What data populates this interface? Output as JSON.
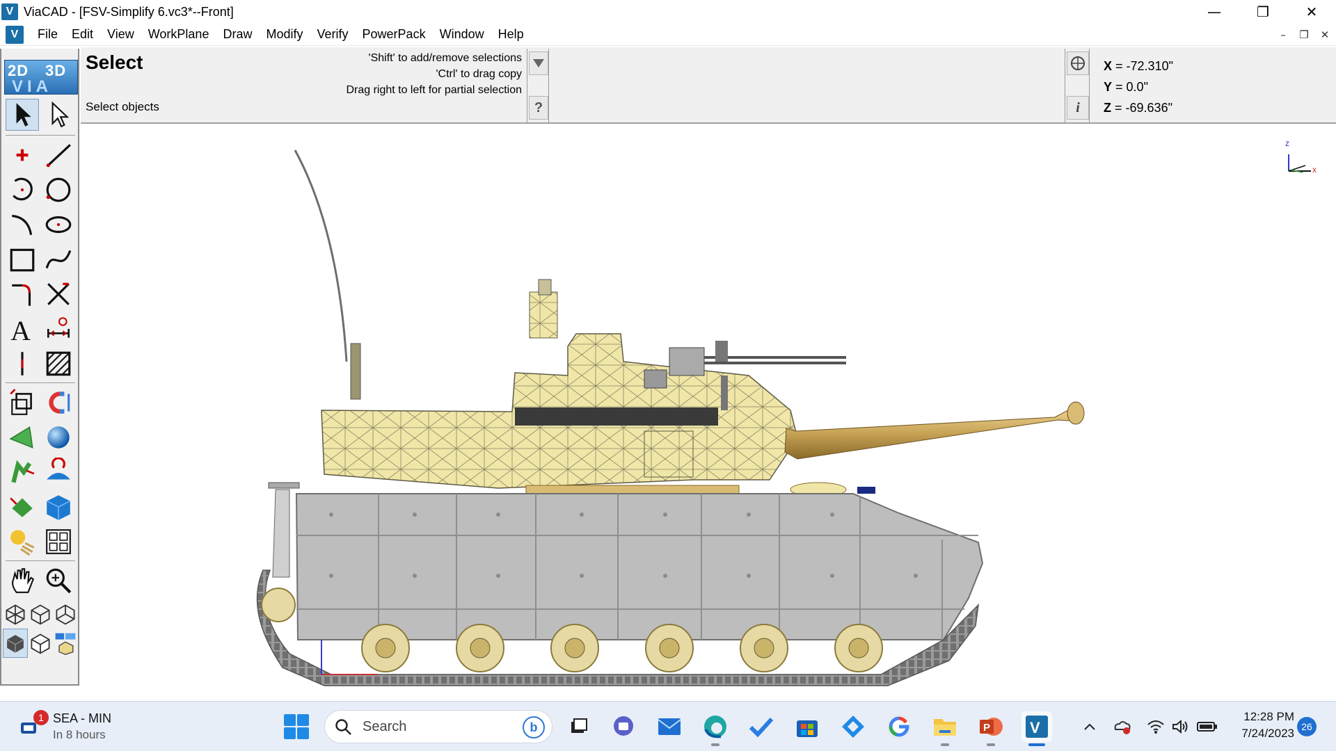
{
  "window": {
    "title": "ViaCAD - [FSV-Simplify 6.vc3*--Front]",
    "app_icon": "viacad-logo",
    "controls": [
      "minimize",
      "restore",
      "close"
    ]
  },
  "menu": {
    "items": [
      "File",
      "Edit",
      "View",
      "WorkPlane",
      "Draw",
      "Modify",
      "Verify",
      "PowerPack",
      "Window",
      "Help"
    ],
    "mdi_controls": [
      "minimize",
      "restore",
      "close"
    ]
  },
  "toolbar": {
    "logo": {
      "top_left": "2D",
      "top_right": "3D",
      "bottom": "VIA"
    },
    "tools": [
      "select-arrow",
      "select-hollow-arrow",
      "point",
      "line",
      "arc",
      "circle",
      "curve-arc",
      "ellipse",
      "rectangle",
      "spline",
      "fillet",
      "trim",
      "text",
      "dimension",
      "centerline",
      "hatch",
      "transform",
      "magnet",
      "extrude",
      "sphere",
      "sweep",
      "revolve",
      "shell",
      "box",
      "materials",
      "layout",
      "pan-hand",
      "zoom",
      "view-iso-1",
      "view-iso-2",
      "view-iso-3",
      "render-shaded",
      "render-wireframe",
      "render-options"
    ]
  },
  "prompt": {
    "tool_name": "Select",
    "description": "Select objects",
    "hints": [
      "'Shift' to add/remove selections",
      "'Ctrl' to drag copy",
      "Drag right to left for partial selection"
    ],
    "buttons": [
      "dropdown-arrow",
      "help"
    ]
  },
  "coordinates": {
    "x_label": "X",
    "x_value": "= -72.310\"",
    "y_label": "Y",
    "y_value": "= 0.0\"",
    "z_label": "Z",
    "z_value": "= -69.636\"",
    "buttons": [
      "snap-target",
      "info"
    ]
  },
  "axis_triad": {
    "z": "z",
    "x": "x"
  },
  "taskbar": {
    "weather_title": "SEA - MIN",
    "weather_sub": "In 8 hours",
    "weather_badge": "1",
    "search_placeholder": "Search",
    "search_bing": "b",
    "clock_time": "12:28 PM",
    "clock_date": "7/24/2023",
    "notifications": "26",
    "pinned": [
      "start",
      "search",
      "task-view",
      "teams-chat",
      "mail",
      "edge",
      "todo",
      "store",
      "app-diamond",
      "google-chrome",
      "file-explorer",
      "powerpoint",
      "viacad"
    ]
  },
  "colors": {
    "hull": "#bdbdbd",
    "turret": "#efe6a8",
    "barrel": "#c9a457",
    "selected_tool": "#cfe0f0",
    "accent": "#1f6fd0"
  }
}
